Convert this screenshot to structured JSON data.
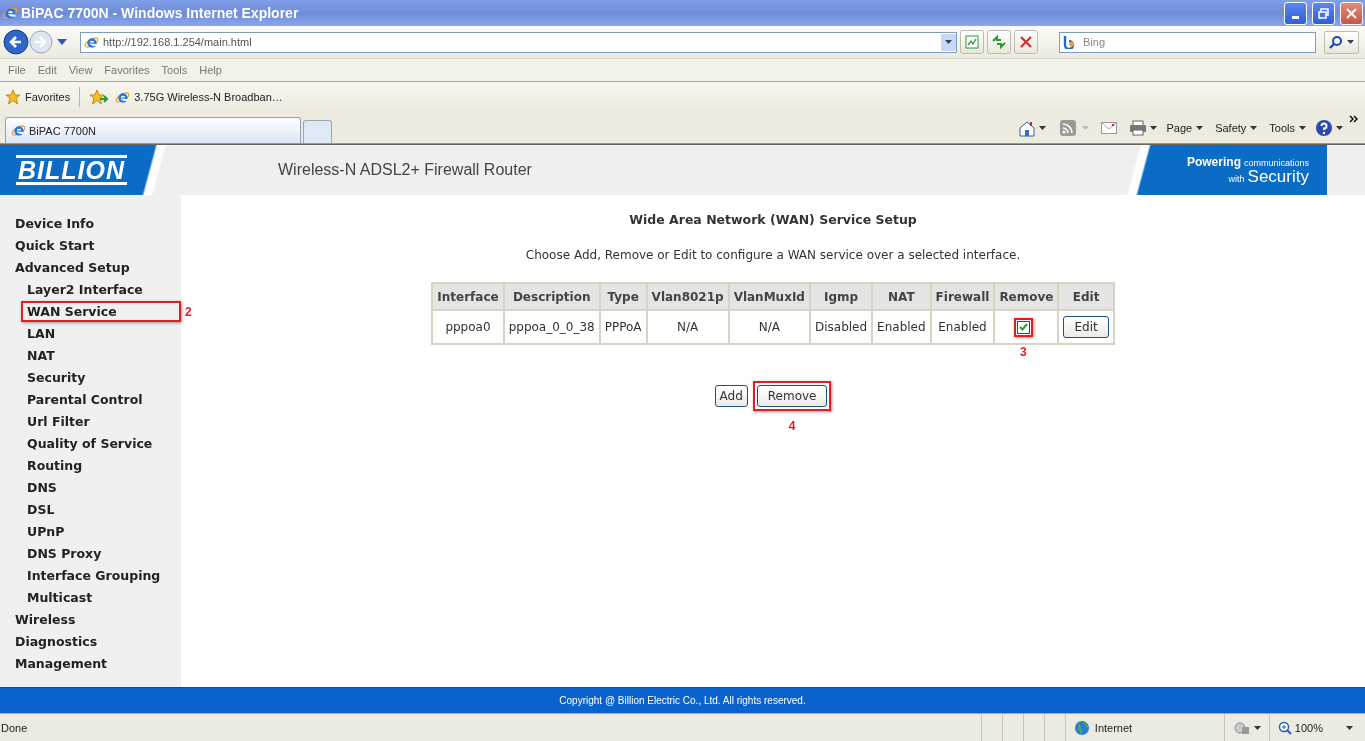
{
  "window": {
    "title": "BiPAC 7700N - Windows Internet Explorer"
  },
  "address_bar": {
    "url": "http://192.168.1.254/main.html"
  },
  "search": {
    "placeholder": "Bing"
  },
  "menu_bar": [
    "File",
    "Edit",
    "View",
    "Favorites",
    "Tools",
    "Help"
  ],
  "favorites_bar": {
    "label": "Favorites",
    "links": [
      "3.75G Wireless-N Broadban…"
    ]
  },
  "tabs": [
    {
      "label": "BiPAC 7700N",
      "selected": true
    }
  ],
  "command_bar": [
    "Page",
    "Safety",
    "Tools"
  ],
  "router_header": {
    "brand": "BILLION",
    "title": "Wireless-N ADSL2+ Firewall Router",
    "tagline": [
      "Powering",
      "communications",
      "with",
      "Security"
    ]
  },
  "sidebar": {
    "items": [
      {
        "label": "Device Info"
      },
      {
        "label": "Quick Start"
      },
      {
        "label": "Advanced Setup",
        "children": [
          {
            "label": "Layer2 Interface"
          },
          {
            "label": "WAN Service",
            "annotation": "2"
          },
          {
            "label": "LAN"
          },
          {
            "label": "NAT"
          },
          {
            "label": "Security"
          },
          {
            "label": "Parental Control"
          },
          {
            "label": "Url Filter"
          },
          {
            "label": "Quality of Service"
          },
          {
            "label": "Routing"
          },
          {
            "label": "DNS"
          },
          {
            "label": "DSL"
          },
          {
            "label": "UPnP"
          },
          {
            "label": "DNS Proxy"
          },
          {
            "label": "Interface Grouping"
          },
          {
            "label": "Multicast"
          }
        ]
      },
      {
        "label": "Wireless"
      },
      {
        "label": "Diagnostics"
      },
      {
        "label": "Management"
      }
    ]
  },
  "content": {
    "title": "Wide Area Network (WAN) Service Setup",
    "instructions": "Choose Add, Remove or Edit to configure a WAN service over a selected interface.",
    "table": {
      "columns": [
        "Interface",
        "Description",
        "Type",
        "Vlan8021p",
        "VlanMuxId",
        "Igmp",
        "NAT",
        "Firewall",
        "Remove",
        "Edit"
      ],
      "rows": [
        [
          {
            "kind": "text",
            "text": "pppoa0"
          },
          {
            "kind": "text",
            "text": "pppoa_0_0_38"
          },
          {
            "kind": "text",
            "text": "PPPoA"
          },
          {
            "kind": "text",
            "text": "N/A"
          },
          {
            "kind": "text",
            "text": "N/A"
          },
          {
            "kind": "text",
            "text": "Disabled"
          },
          {
            "kind": "text",
            "text": "Enabled"
          },
          {
            "kind": "text",
            "text": "Enabled"
          },
          {
            "kind": "checkbox",
            "checked": true,
            "annotation": "3"
          },
          {
            "kind": "button",
            "label": "Edit"
          }
        ]
      ]
    },
    "buttons": [
      {
        "label": "Add"
      },
      {
        "label": "Remove",
        "annotation": "4"
      }
    ]
  },
  "footer": {
    "copyright": "Copyright @ Billion Electric Co., Ltd. All rights reserved."
  },
  "status_bar": {
    "text": "Done",
    "zone": "Internet",
    "zoom": "100%"
  }
}
